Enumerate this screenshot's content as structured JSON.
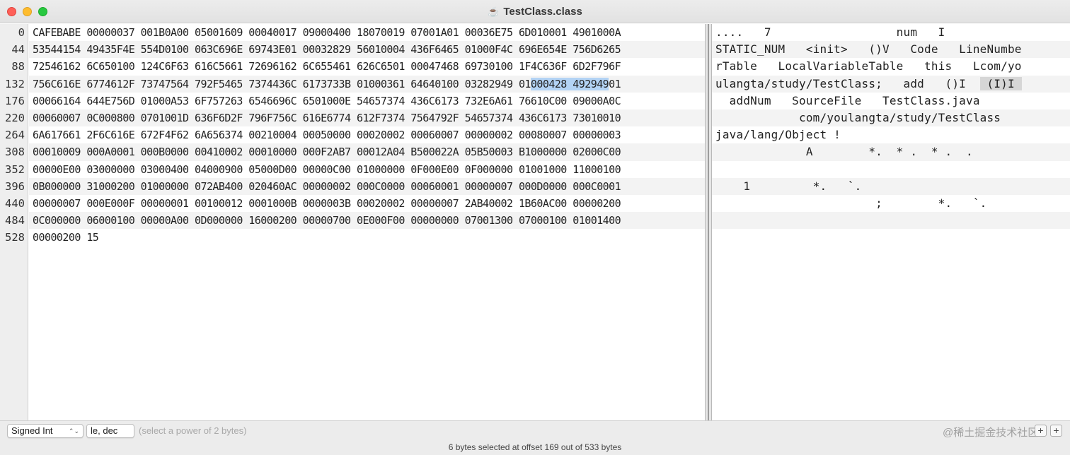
{
  "window": {
    "title": "TestClass.class",
    "title_icon": "☕"
  },
  "gutter": {
    "offsets": [
      "0",
      "44",
      "88",
      "132",
      "176",
      "220",
      "264",
      "308",
      "352",
      "396",
      "440",
      "484",
      "528"
    ]
  },
  "hex": {
    "rows": [
      "CAFEBABE 00000037 001B0A00 05001609 00040017 09000400 18070019 07001A01 00036E75 6D010001 4901000A",
      "53544154 49435F4E 554D0100 063C696E 69743E01 00032829 56010004 436F6465 01000F4C 696E654E 756D6265",
      "72546162 6C650100 124C6F63 616C5661 72696162 6C655461 626C6501 00047468 69730100 1F4C636F 6D2F796F",
      "756C616E 6774612F 73747564 792F5465 7374436C 6173733B 01000361 64640100 03282949 01000428 49294901",
      "00066164 644E756D 01000A53 6F757263 6546696C 6501000E 54657374 436C6173 732E6A61 76610C00 09000A0C",
      "00060007 0C000800 0701001D 636F6D2F 796F756C 616E6774 612F7374 7564792F 54657374 436C6173 73010010",
      "6A617661 2F6C616E 672F4F62 6A656374 00210004 00050000 00020002 00060007 00000002 00080007 00000003",
      "00010009 000A0001 000B0000 00410002 00010000 000F2AB7 00012A04 B500022A 05B50003 B1000000 02000C00",
      "00000E00 03000000 03000400 04000900 05000D00 00000C00 01000000 0F000E00 0F000000 01001000 11000100",
      "0B000000 31000200 01000000 072AB400 020460AC 00000002 000C0000 00060001 00000007 000D0000 000C0001",
      "00000007 000E000F 00000001 00100012 0001000B 0000003B 00020002 00000007 2AB40002 1B60AC00 00000200",
      "0C000000 06000100 00000A00 0D000000 16000200 00000700 0E000F00 00000000 07001300 07000100 01001400",
      "00000200 15"
    ],
    "selected_row_index": 3,
    "selected_row_prefix": "756C616E 6774612F 73747564 792F5465 7374436C 6173733B 01000361 64640100 03282949 01",
    "selected_text": "000428 492949",
    "selected_row_suffix": "01"
  },
  "text": {
    "rows": [
      "....   7                  num   I",
      "STATIC_NUM   <init>   ()V   Code   LineNumbe",
      "rTable   LocalVariableTable   this   Lcom/yo",
      "ulangta/study/TestClass;   add   ()I   (I)I",
      "  addNum   SourceFile   TestClass.java",
      "            com/youlangta/study/TestClass",
      "java/lang/Object !",
      "             A        *.  * .  * .  .",
      "",
      "    1         *.   `.",
      "                       ;        *.   `.",
      "",
      ""
    ],
    "selected_row_index": 3,
    "selected_row_prefix": "ulangta/study/TestClass;   add   ()I  ",
    "selected_text": " (I)I ",
    "selected_row_suffix": ""
  },
  "bottom": {
    "type_select": "Signed Int",
    "endian_select": "le, dec",
    "hint": "(select a power of 2 bytes)",
    "status": "6 bytes selected at offset 169 out of 533 bytes",
    "watermark": "@稀土掘金技术社区",
    "add_button_label": "+"
  }
}
